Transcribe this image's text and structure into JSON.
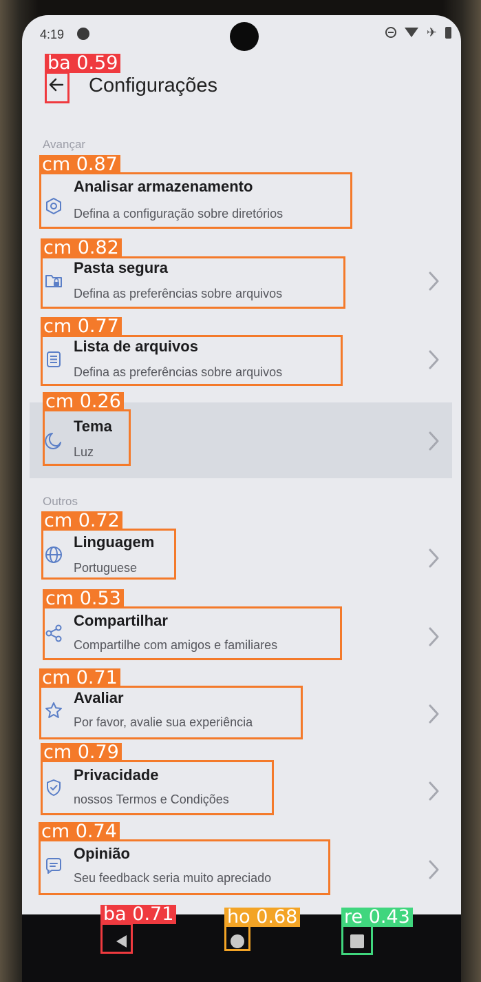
{
  "status": {
    "time": "4:19"
  },
  "header": {
    "title": "Configurações"
  },
  "sections": {
    "advanced_label": "Avançar",
    "others_label": "Outros"
  },
  "items": [
    {
      "title": "Analisar armazenamento",
      "subtitle": "Defina a configuração sobre diretórios",
      "icon": "hexagon-settings-icon"
    },
    {
      "title": "Pasta segura",
      "subtitle": "Defina as preferências sobre arquivos",
      "icon": "lock-folder-icon"
    },
    {
      "title": "Lista de arquivos",
      "subtitle": "Defina as preferências sobre arquivos",
      "icon": "file-list-icon"
    },
    {
      "title": "Tema",
      "subtitle": "Luz",
      "icon": "moon-icon"
    },
    {
      "title": "Linguagem",
      "subtitle": "Portuguese",
      "icon": "globe-icon"
    },
    {
      "title": "Compartilhar",
      "subtitle": "Compartilhe com amigos e familiares",
      "icon": "share-icon"
    },
    {
      "title": "Avaliar",
      "subtitle": "Por favor, avalie sua experiência",
      "icon": "star-icon"
    },
    {
      "title": "Privacidade",
      "subtitle": "nossos Termos e Condições",
      "icon": "shield-check-icon"
    },
    {
      "title": "Opinião",
      "subtitle": "Seu feedback seria muito apreciado",
      "icon": "chat-icon"
    }
  ],
  "detections": {
    "back": "ba 0.59",
    "items": [
      "cm 0.87",
      "cm 0.82",
      "cm 0.77",
      "cm 0.26",
      "cm 0.72",
      "cm 0.53",
      "cm 0.71",
      "cm 0.79",
      "cm 0.74"
    ],
    "nav_back": "ba 0.71",
    "nav_home": "ho 0.68",
    "nav_recents": "re 0.43"
  },
  "colors": {
    "accent_icon": "#5b7fc7",
    "detection_orange": "#f47a2a",
    "detection_red": "#ef3a3f",
    "detection_yellow": "#f3a426",
    "detection_green": "#40d67e"
  }
}
